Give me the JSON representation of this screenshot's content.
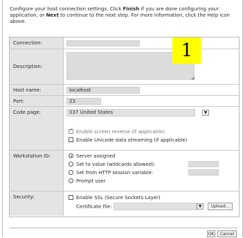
{
  "intro": {
    "part1": "Configure your host connection settings. Click ",
    "finish": "Finish",
    "part2": " if you are done configuring your application, or ",
    "next": "Next",
    "part3": " to continue to the next step. For more information, click the Help icon above."
  },
  "labels": {
    "connection": "Connection:",
    "description": "Description:",
    "host_name": "Host name:",
    "port": "Port:",
    "code_page": "Code page:",
    "workstation_id": "Workstation ID:",
    "security": "Security:"
  },
  "values": {
    "connection": "",
    "description": "",
    "host_name": "localhost",
    "port": "23",
    "code_page": "037 United States"
  },
  "code_page_options": {
    "reverse": {
      "label": "Enable screen reverse (if applicable)",
      "checked": true,
      "enabled": false
    },
    "unicode": {
      "label": "Enable Unicode data streaming (if applicable)",
      "checked": false,
      "enabled": true
    }
  },
  "workstation": {
    "options": [
      {
        "label": "Server assigned",
        "selected": true
      },
      {
        "label": "Set to value (wildcards allowed):",
        "selected": false
      },
      {
        "label": "Set from HTTP session variable:",
        "selected": false
      },
      {
        "label": "Prompt user",
        "selected": false
      }
    ]
  },
  "security": {
    "ssl_label": "Enable SSL (Secure Sockets Layer)",
    "cert_label": "Certificate file:",
    "upload_label": "Upload..."
  },
  "buttons": {
    "ok": "OK",
    "cancel": "Cancel"
  },
  "callout": "1",
  "icons": {
    "dropdown": "chevron-down-icon"
  }
}
